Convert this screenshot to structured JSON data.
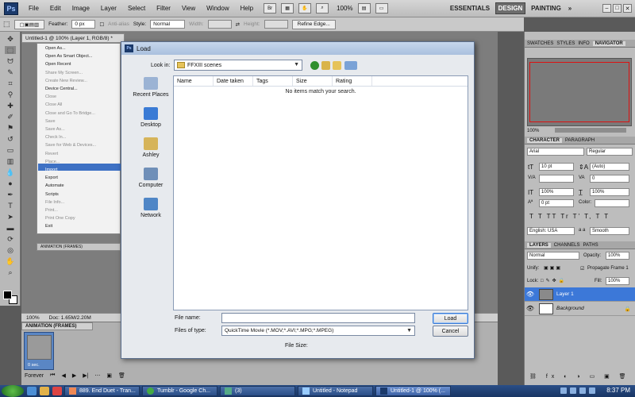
{
  "app": {
    "logo": "Ps",
    "menu": [
      "File",
      "Edit",
      "Image",
      "Layer",
      "Select",
      "Filter",
      "View",
      "Window",
      "Help"
    ],
    "zoom": "100%",
    "workspaces": [
      "ESSENTIALS",
      "DESIGN",
      "PAINTING"
    ],
    "window_buttons": [
      "–",
      "□",
      "✕"
    ]
  },
  "options_bar": {
    "feather_label": "Feather:",
    "feather_value": "0 px",
    "antialias_label": "Anti-alias",
    "style_label": "Style:",
    "style_value": "Normal",
    "width_label": "Width:",
    "height_label": "Height:",
    "refine_edge": "Refine Edge..."
  },
  "document": {
    "tab_title": "Untitled-1 @ 100% (Layer 1, RGB/8) *",
    "status_zoom": "100%",
    "status_doc": "Doc: 1.65M/2.20M"
  },
  "file_menu": {
    "items": [
      {
        "label": "Open As...",
        "dim": false
      },
      {
        "label": "Open As Smart Object...",
        "dim": false
      },
      {
        "label": "Open Recent",
        "dim": false
      },
      {
        "label": "Share My Screen...",
        "dim": true
      },
      {
        "label": "Create New Review...",
        "dim": true
      },
      {
        "label": "Device Central...",
        "dim": false
      },
      {
        "label": "Close",
        "dim": true
      },
      {
        "label": "Close All",
        "dim": true
      },
      {
        "label": "Close and Go To Bridge...",
        "dim": true
      },
      {
        "label": "Save",
        "dim": true
      },
      {
        "label": "Save As...",
        "dim": true
      },
      {
        "label": "Check In...",
        "dim": true
      },
      {
        "label": "Save for Web & Devices...",
        "dim": true
      },
      {
        "label": "Revert",
        "dim": true
      },
      {
        "label": "Place...",
        "dim": true
      },
      {
        "label": "Import",
        "dim": false
      },
      {
        "label": "Export",
        "dim": false
      },
      {
        "label": "Automate",
        "dim": false
      },
      {
        "label": "Scripts",
        "dim": false
      },
      {
        "label": "File Info...",
        "dim": true
      },
      {
        "label": "Print...",
        "dim": true
      },
      {
        "label": "Print One Copy",
        "dim": true
      },
      {
        "label": "Exit",
        "dim": false
      }
    ],
    "highlighted": "Import"
  },
  "animation_panel": {
    "tab": "ANIMATION (FRAMES)",
    "frame_time": "0 sec.",
    "loop": "Forever",
    "inner_tab": "ANIMATION (FRAMES)"
  },
  "right_panels": {
    "navigator_tabs": [
      "SWATCHES",
      "STYLES",
      "INFO",
      "NAVIGATOR"
    ],
    "navigator_zoom": "100%",
    "character_tabs": [
      "CHARACTER",
      "PARAGRAPH"
    ],
    "font_family": "Arial",
    "font_style": "Regular",
    "font_size": "10 pt",
    "leading": "(Auto)",
    "kerning": "",
    "tracking": "0",
    "vscale": "100%",
    "hscale": "100%",
    "baseline": "0 pt",
    "color_label": "Color:",
    "language": "English: USA",
    "aa_label": "a a",
    "antialias": "Smooth",
    "type_styles": "T T TT Tr T' T, T T",
    "layers_tabs": [
      "LAYERS",
      "CHANNELS",
      "PATHS"
    ],
    "blend_mode": "Normal",
    "opacity_label": "Opacity:",
    "opacity": "100%",
    "unify_label": "Unify:",
    "propagate": "Propagate Frame 1",
    "lock_label": "Lock:",
    "fill_label": "Fill:",
    "fill": "100%",
    "layers": [
      {
        "name": "Layer 1",
        "selected": true
      },
      {
        "name": "Background",
        "selected": false
      }
    ]
  },
  "dialog": {
    "title": "Load",
    "look_in_label": "Look in:",
    "look_in_value": "FFXIII scenes",
    "places": [
      "Recent Places",
      "Desktop",
      "Ashley",
      "Computer",
      "Network"
    ],
    "columns": [
      "Name",
      "Date taken",
      "Tags",
      "Size",
      "Rating"
    ],
    "empty_message": "No items match your search.",
    "file_name_label": "File name:",
    "file_name_value": "",
    "files_of_type_label": "Files of type:",
    "files_of_type_value": "QuickTime Movie (*.MOV;*.AVI;*.MPG;*.MPEG)",
    "load_button": "Load",
    "cancel_button": "Cancel",
    "file_size_label": "File Size:"
  },
  "taskbar": {
    "buttons": [
      "889. End Duet - Tran...",
      "Tumblr - Google Ch...",
      "(3)",
      "Untitled - Notepad",
      "Untitled-1 @ 100% (..."
    ],
    "clock": "8:37 PM"
  }
}
